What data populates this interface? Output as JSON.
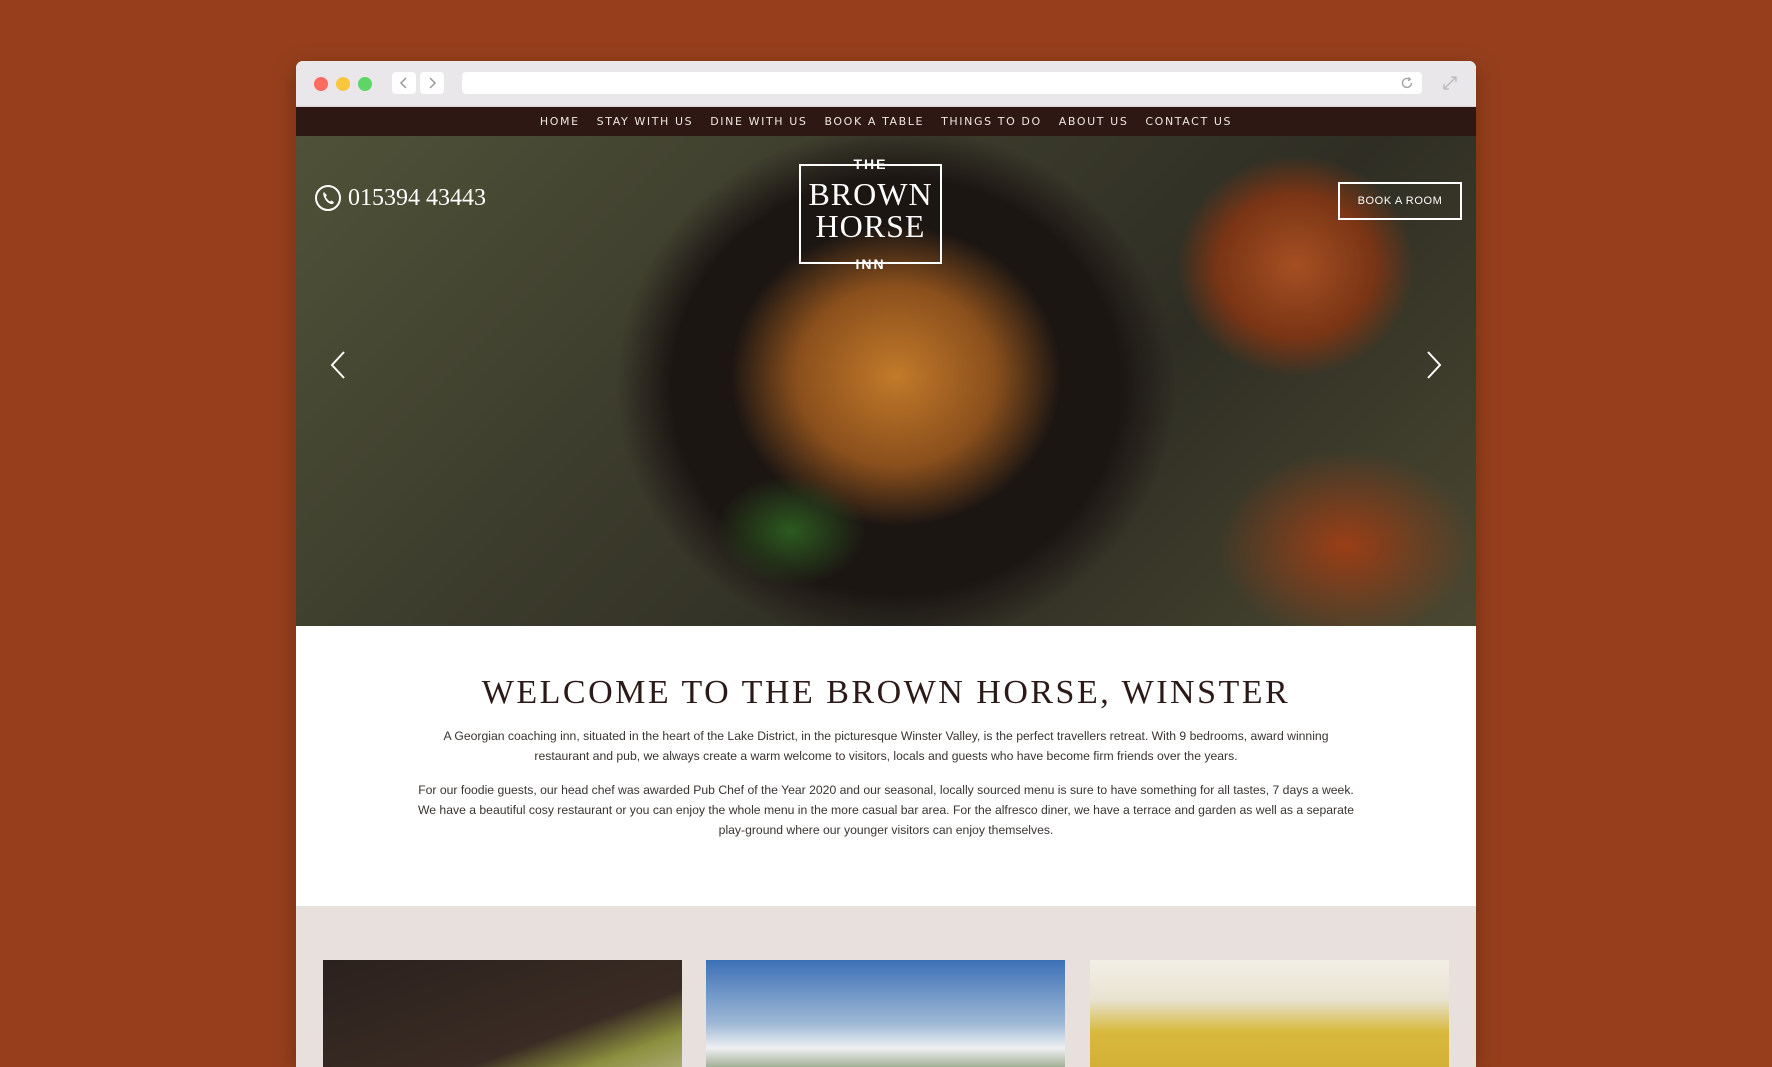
{
  "nav": {
    "items": [
      "HOME",
      "STAY WITH US",
      "DINE WITH US",
      "BOOK A TABLE",
      "THINGS TO DO",
      "ABOUT US",
      "CONTACT US"
    ]
  },
  "hero": {
    "phone": "015394 43443",
    "logo": {
      "the": "THE",
      "brown": "BROWN",
      "horse": "HORSE",
      "inn": "INN"
    },
    "book_room": "BOOK A ROOM"
  },
  "welcome": {
    "title": "WELCOME TO THE BROWN HORSE, WINSTER",
    "paragraph1": "A Georgian coaching inn, situated in the heart of the Lake District, in the picturesque Winster Valley,  is the perfect travellers retreat. With 9 bedrooms, award winning restaurant and pub, we always create a warm welcome to visitors, locals and guests who have become firm friends over the years.",
    "paragraph2": "For our foodie guests, our head chef was awarded Pub Chef of the Year 2020 and our seasonal, locally sourced menu is sure to have something for all tastes, 7 days a week. We have a beautiful cosy restaurant or you can enjoy the whole menu in the more casual bar area. For the alfresco diner, we have a terrace and garden as well as a separate play-ground where our younger visitors can enjoy themselves."
  },
  "colors": {
    "page_background": "#973f1c",
    "nav_background": "#2d1813",
    "heading": "#2b1a17",
    "cards_background": "#e8e0dd"
  },
  "icons": [
    "back-icon",
    "forward-icon",
    "reload-icon",
    "expand-icon",
    "phone-icon",
    "chevron-left-icon",
    "chevron-right-icon"
  ]
}
